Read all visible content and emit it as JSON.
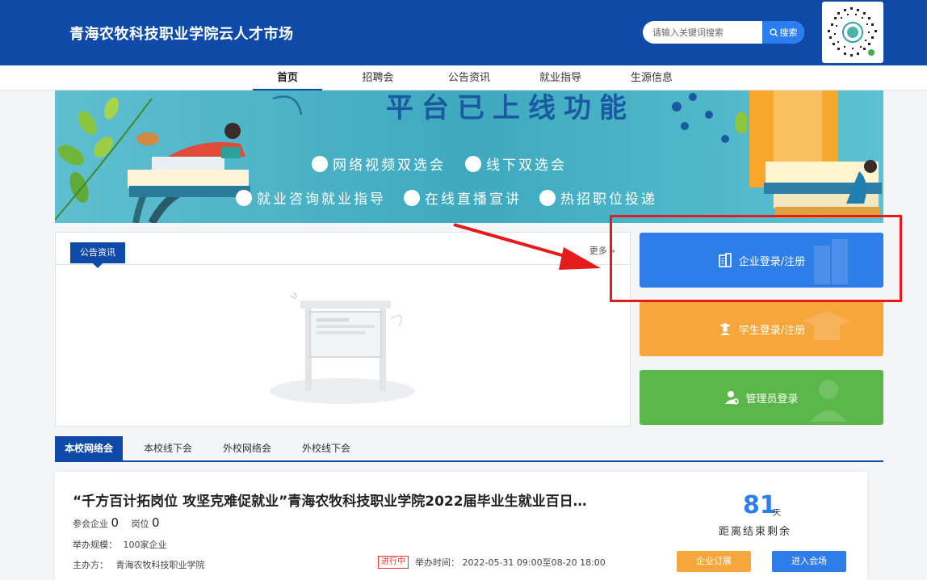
{
  "header": {
    "site_title": "青海农牧科技职业学院云人才市场",
    "search_placeholder": "请输入关键词搜索",
    "search_button": "搜索"
  },
  "nav": {
    "items": [
      "首页",
      "招聘会",
      "公告资讯",
      "就业指导",
      "生源信息"
    ],
    "active": "首页"
  },
  "banner": {
    "heading": "平台已上线功能",
    "line1": [
      "网络视频双选会",
      "线下双选会"
    ],
    "line2": [
      "就业咨询就业指导",
      "在线直播宣讲",
      "热招职位投递"
    ]
  },
  "notice": {
    "tab_label": "公告资讯",
    "more_label": "更多"
  },
  "login": {
    "company": "企业登录/注册",
    "student": "学生登录/注册",
    "admin": "管理员登录"
  },
  "colors": {
    "brand": "#0f4aa8",
    "company": "#2e7de8",
    "student": "#f7a63c",
    "admin": "#5ab84a",
    "annotation": "#e51b1b"
  },
  "fair_tabs": [
    "本校网络会",
    "本校线下会",
    "外校网络会",
    "外校线下会"
  ],
  "fair": {
    "title": "“千方百计拓岗位 攻坚克难促就业”青海农牧科技职业学院2022届毕业生就业百日…",
    "companies_label": "参会企业",
    "companies_value": "0",
    "positions_label": "岗位",
    "positions_value": "0",
    "scale_label": "举办规模：",
    "scale_value": "100家企业",
    "host_label": "主办方：",
    "host_value": "青海农牧科技职业学院",
    "status": "进行中",
    "time_label": "举办时间：",
    "time_value": "2022-05-31 09:00至08-20 18:00",
    "days_left": "81",
    "days_unit": "天",
    "remaining_label": "距离结束剩余",
    "subscribe_button": "企业订展",
    "enter_button": "进入会场"
  }
}
